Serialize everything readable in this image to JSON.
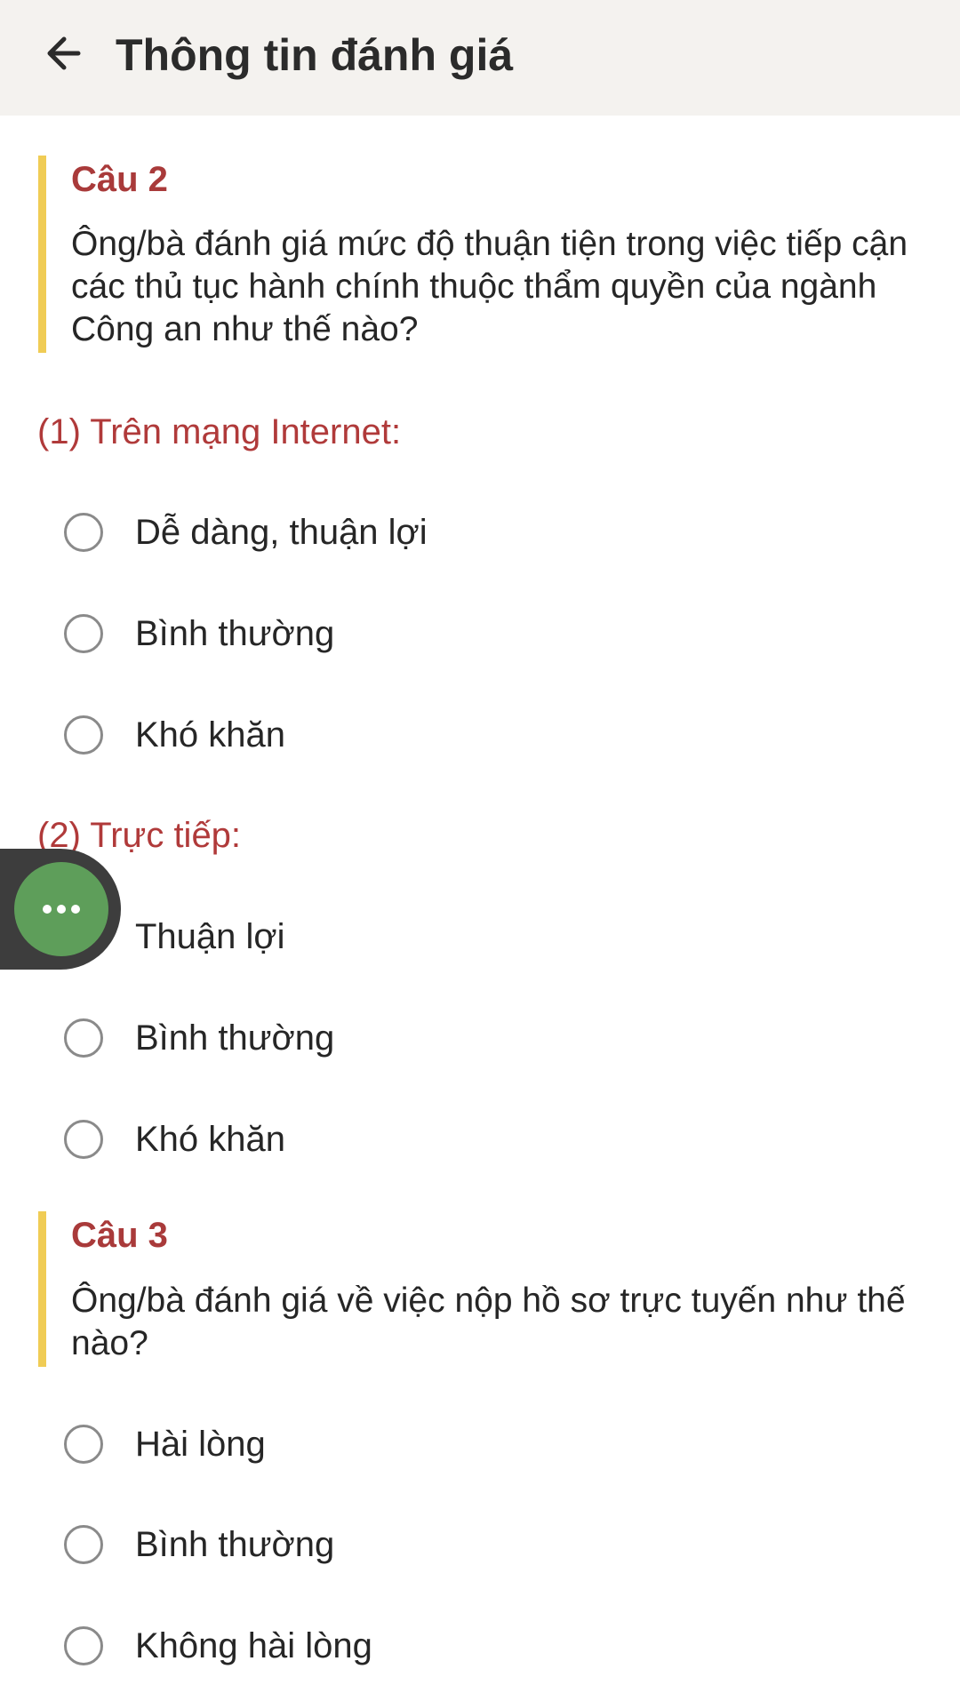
{
  "header": {
    "title": "Thông tin đánh giá",
    "back_icon": "arrow-left-icon"
  },
  "questions": [
    {
      "number": "Câu 2",
      "text": "Ông/bà đánh giá mức độ thuận tiện trong việc tiếp cận các thủ tục hành chính thuộc thẩm quyền của ngành Công an như thế nào?",
      "groups": [
        {
          "heading": "(1) Trên mạng Internet:",
          "options": [
            "Dễ dàng, thuận lợi",
            "Bình thường",
            "Khó khăn"
          ]
        },
        {
          "heading": "(2) Trực tiếp:",
          "options": [
            "Thuận lợi",
            "Bình thường",
            "Khó khăn"
          ]
        }
      ]
    },
    {
      "number": "Câu 3",
      "text": "Ông/bà đánh giá về việc nộp hồ sơ trực tuyến như thế nào?",
      "options": [
        "Hài lòng",
        "Bình thường",
        "Không hài lòng"
      ]
    }
  ],
  "floating_menu": {
    "icon": "more-horizontal-icon",
    "color": "#5e9e5a"
  },
  "colors": {
    "accent_bar": "#f0cc55",
    "question_number": "#a93a3a",
    "subheading": "#b03a3a",
    "header_bg": "#f4f2ef"
  }
}
